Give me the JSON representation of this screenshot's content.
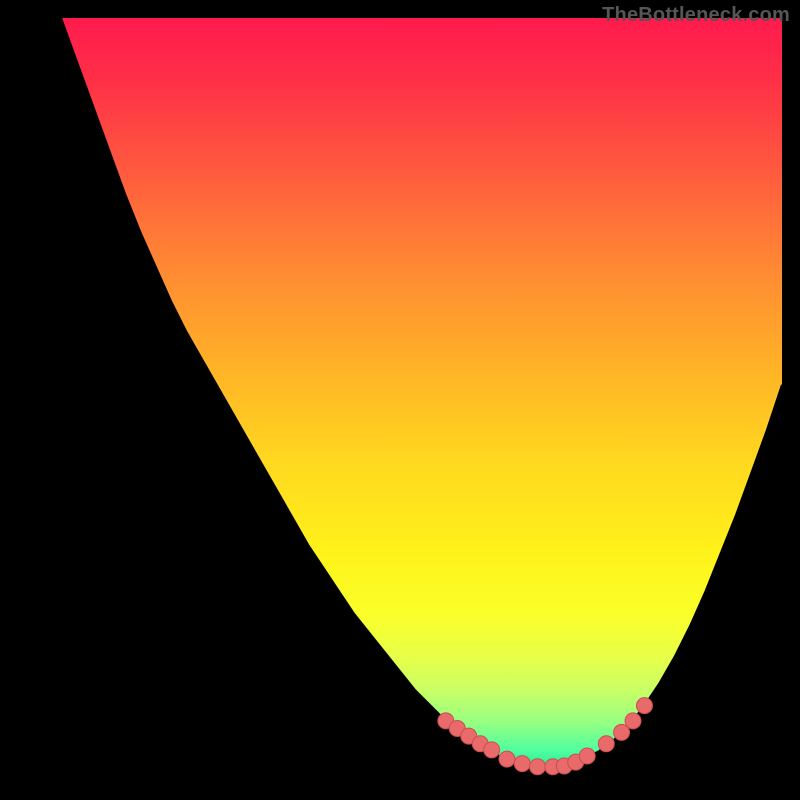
{
  "watermark": "TheBottleneck.com",
  "colors": {
    "dot_fill": "#e86a6a",
    "dot_stroke": "#c94f4f",
    "curve": "#000000",
    "mask": "#000000"
  },
  "chart_data": {
    "type": "line",
    "title": "",
    "xlabel": "",
    "ylabel": "",
    "xlim": [
      0,
      100
    ],
    "ylim": [
      0,
      100
    ],
    "x": [
      0,
      2,
      4,
      6,
      8,
      10,
      12,
      14,
      16,
      18,
      20,
      22,
      24,
      26,
      28,
      30,
      32,
      34,
      36,
      38,
      40,
      42,
      44,
      46,
      48,
      50,
      52,
      54,
      56,
      58,
      60,
      62,
      64,
      66,
      68,
      70,
      72,
      74,
      76,
      78,
      80,
      82,
      84,
      86,
      88,
      90,
      92,
      94,
      96,
      98,
      100
    ],
    "values": [
      115,
      110,
      104.5,
      99,
      93.5,
      88,
      82.5,
      77,
      72,
      67.5,
      63,
      59,
      55.5,
      52,
      48.5,
      45,
      41.5,
      38,
      34.5,
      31,
      28,
      25,
      22,
      19.5,
      17,
      14.5,
      12,
      10,
      8,
      6.5,
      5,
      3.8,
      3,
      2.4,
      2,
      2,
      2.3,
      3,
      4,
      5.5,
      7.5,
      10,
      13,
      16.5,
      20.5,
      25,
      30,
      35,
      40.5,
      46,
      52
    ],
    "dots": [
      {
        "x": 56,
        "y": 8
      },
      {
        "x": 57.5,
        "y": 7
      },
      {
        "x": 59,
        "y": 6
      },
      {
        "x": 60.5,
        "y": 5
      },
      {
        "x": 62,
        "y": 4.2
      },
      {
        "x": 64,
        "y": 3
      },
      {
        "x": 66,
        "y": 2.4
      },
      {
        "x": 68,
        "y": 2
      },
      {
        "x": 70,
        "y": 2
      },
      {
        "x": 71.5,
        "y": 2.1
      },
      {
        "x": 73,
        "y": 2.6
      },
      {
        "x": 74.5,
        "y": 3.4
      },
      {
        "x": 77,
        "y": 5
      },
      {
        "x": 79,
        "y": 6.5
      },
      {
        "x": 80.5,
        "y": 8
      },
      {
        "x": 82,
        "y": 10
      }
    ]
  }
}
